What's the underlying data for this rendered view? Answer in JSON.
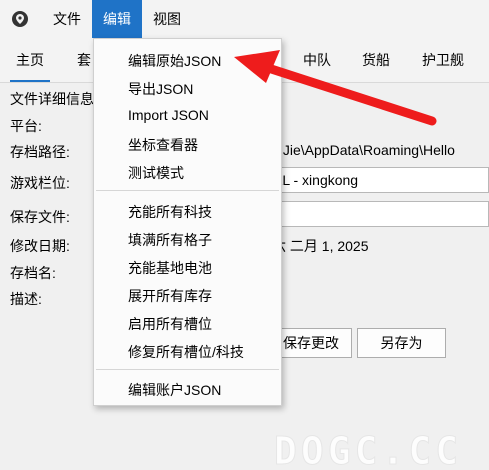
{
  "menubar": {
    "items": [
      "文件",
      "编辑",
      "视图"
    ]
  },
  "tabs": [
    "主页",
    "套",
    "中队",
    "货船",
    "护卫舰"
  ],
  "form": {
    "labels": [
      "文件详细信息",
      "平台:",
      "存档路径:",
      "游戏栏位:",
      "保存文件:",
      "修改日期:",
      "存档名:",
      "描述:"
    ],
    "save_path_value": "niJie\\AppData\\Roaming\\Hello",
    "game_slot_value": "AL - xingkong",
    "modified_date_value": "六 二月 1, 2025"
  },
  "buttons": {
    "save_changes": "保存更改",
    "save_as": "另存为"
  },
  "edit_menu": {
    "group1": [
      "编辑原始JSON",
      "导出JSON",
      "Import JSON",
      "坐标查看器",
      "测试模式"
    ],
    "group2": [
      "充能所有科技",
      "填满所有格子",
      "充能基地电池",
      "展开所有库存",
      "启用所有槽位",
      "修复所有槽位/科技"
    ],
    "group3": [
      "编辑账户JSON"
    ]
  },
  "annotation": {
    "arrow_color": "#ee1c1c"
  },
  "watermark": {
    "text": "DOGC.CC"
  }
}
